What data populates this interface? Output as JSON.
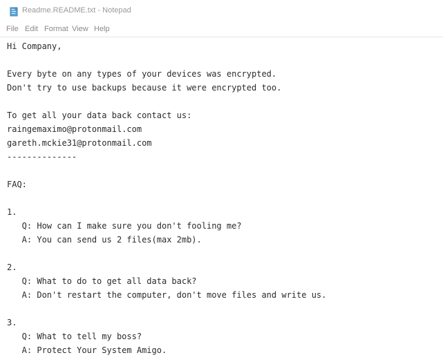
{
  "window": {
    "title": "Readme.README.txt - Notepad",
    "icon": "notepad-icon"
  },
  "menu": {
    "items": [
      {
        "label": "File"
      },
      {
        "label": "Edit"
      },
      {
        "label": "Format"
      },
      {
        "label": "View"
      },
      {
        "label": "Help"
      }
    ]
  },
  "document": {
    "lines": [
      "Hi Company,",
      "",
      "Every byte on any types of your devices was encrypted.",
      "Don't try to use backups because it were encrypted too.",
      "",
      "To get all your data back contact us:",
      "raingemaximo@protonmail.com",
      "gareth.mckie31@protonmail.com",
      "--------------",
      "",
      "FAQ:",
      "",
      "1.",
      "   Q: How can I make sure you don't fooling me?",
      "   A: You can send us 2 files(max 2mb).",
      "",
      "2.",
      "   Q: What to do to get all data back?",
      "   A: Don't restart the computer, don't move files and write us.",
      "",
      "3.",
      "   Q: What to tell my boss?",
      "   A: Protect Your System Amigo."
    ]
  }
}
